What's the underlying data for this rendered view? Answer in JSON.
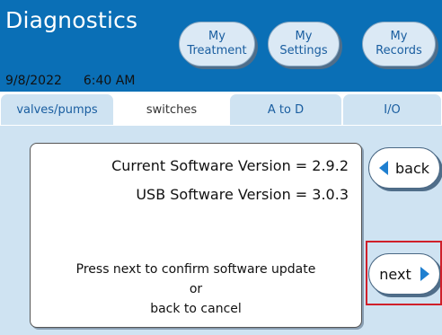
{
  "header": {
    "title": "Diagnostics",
    "date": "9/8/2022",
    "time": "6:40 AM",
    "nav": [
      {
        "line1": "My",
        "line2": "Treatment"
      },
      {
        "line1": "My",
        "line2": "Settings"
      },
      {
        "line1": "My",
        "line2": "Records"
      }
    ]
  },
  "tabs": [
    {
      "label": "valves/pumps"
    },
    {
      "label": "switches"
    },
    {
      "label": "A to D"
    },
    {
      "label": "I/O"
    }
  ],
  "active_tab": "switches",
  "panel": {
    "current_version": "Current Software Version = 2.9.2",
    "usb_version": "USB Software Version = 3.0.3",
    "prompt_line1": "Press next to confirm software  update",
    "prompt_line2": "or",
    "prompt_line3": "back to cancel"
  },
  "buttons": {
    "back_label": "back",
    "next_label": "next"
  },
  "colors": {
    "header": "#0a6fb6",
    "content_bg": "#cfe3f2",
    "accent": "#1f7fd0",
    "highlight": "#d0202a"
  },
  "icons": {
    "back": "triangle-left-icon",
    "next": "triangle-right-icon"
  }
}
